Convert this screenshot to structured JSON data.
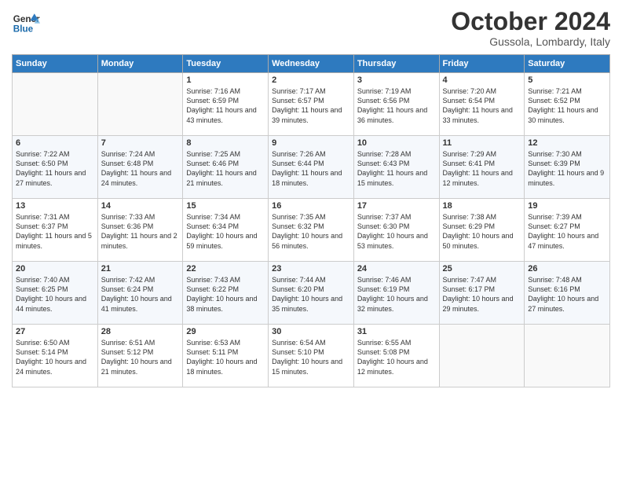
{
  "header": {
    "logo_line1": "General",
    "logo_line2": "Blue",
    "month": "October 2024",
    "location": "Gussola, Lombardy, Italy"
  },
  "days_of_week": [
    "Sunday",
    "Monday",
    "Tuesday",
    "Wednesday",
    "Thursday",
    "Friday",
    "Saturday"
  ],
  "weeks": [
    [
      {
        "day": "",
        "detail": ""
      },
      {
        "day": "",
        "detail": ""
      },
      {
        "day": "1",
        "detail": "Sunrise: 7:16 AM\nSunset: 6:59 PM\nDaylight: 11 hours and 43 minutes."
      },
      {
        "day": "2",
        "detail": "Sunrise: 7:17 AM\nSunset: 6:57 PM\nDaylight: 11 hours and 39 minutes."
      },
      {
        "day": "3",
        "detail": "Sunrise: 7:19 AM\nSunset: 6:56 PM\nDaylight: 11 hours and 36 minutes."
      },
      {
        "day": "4",
        "detail": "Sunrise: 7:20 AM\nSunset: 6:54 PM\nDaylight: 11 hours and 33 minutes."
      },
      {
        "day": "5",
        "detail": "Sunrise: 7:21 AM\nSunset: 6:52 PM\nDaylight: 11 hours and 30 minutes."
      }
    ],
    [
      {
        "day": "6",
        "detail": "Sunrise: 7:22 AM\nSunset: 6:50 PM\nDaylight: 11 hours and 27 minutes."
      },
      {
        "day": "7",
        "detail": "Sunrise: 7:24 AM\nSunset: 6:48 PM\nDaylight: 11 hours and 24 minutes."
      },
      {
        "day": "8",
        "detail": "Sunrise: 7:25 AM\nSunset: 6:46 PM\nDaylight: 11 hours and 21 minutes."
      },
      {
        "day": "9",
        "detail": "Sunrise: 7:26 AM\nSunset: 6:44 PM\nDaylight: 11 hours and 18 minutes."
      },
      {
        "day": "10",
        "detail": "Sunrise: 7:28 AM\nSunset: 6:43 PM\nDaylight: 11 hours and 15 minutes."
      },
      {
        "day": "11",
        "detail": "Sunrise: 7:29 AM\nSunset: 6:41 PM\nDaylight: 11 hours and 12 minutes."
      },
      {
        "day": "12",
        "detail": "Sunrise: 7:30 AM\nSunset: 6:39 PM\nDaylight: 11 hours and 9 minutes."
      }
    ],
    [
      {
        "day": "13",
        "detail": "Sunrise: 7:31 AM\nSunset: 6:37 PM\nDaylight: 11 hours and 5 minutes."
      },
      {
        "day": "14",
        "detail": "Sunrise: 7:33 AM\nSunset: 6:36 PM\nDaylight: 11 hours and 2 minutes."
      },
      {
        "day": "15",
        "detail": "Sunrise: 7:34 AM\nSunset: 6:34 PM\nDaylight: 10 hours and 59 minutes."
      },
      {
        "day": "16",
        "detail": "Sunrise: 7:35 AM\nSunset: 6:32 PM\nDaylight: 10 hours and 56 minutes."
      },
      {
        "day": "17",
        "detail": "Sunrise: 7:37 AM\nSunset: 6:30 PM\nDaylight: 10 hours and 53 minutes."
      },
      {
        "day": "18",
        "detail": "Sunrise: 7:38 AM\nSunset: 6:29 PM\nDaylight: 10 hours and 50 minutes."
      },
      {
        "day": "19",
        "detail": "Sunrise: 7:39 AM\nSunset: 6:27 PM\nDaylight: 10 hours and 47 minutes."
      }
    ],
    [
      {
        "day": "20",
        "detail": "Sunrise: 7:40 AM\nSunset: 6:25 PM\nDaylight: 10 hours and 44 minutes."
      },
      {
        "day": "21",
        "detail": "Sunrise: 7:42 AM\nSunset: 6:24 PM\nDaylight: 10 hours and 41 minutes."
      },
      {
        "day": "22",
        "detail": "Sunrise: 7:43 AM\nSunset: 6:22 PM\nDaylight: 10 hours and 38 minutes."
      },
      {
        "day": "23",
        "detail": "Sunrise: 7:44 AM\nSunset: 6:20 PM\nDaylight: 10 hours and 35 minutes."
      },
      {
        "day": "24",
        "detail": "Sunrise: 7:46 AM\nSunset: 6:19 PM\nDaylight: 10 hours and 32 minutes."
      },
      {
        "day": "25",
        "detail": "Sunrise: 7:47 AM\nSunset: 6:17 PM\nDaylight: 10 hours and 29 minutes."
      },
      {
        "day": "26",
        "detail": "Sunrise: 7:48 AM\nSunset: 6:16 PM\nDaylight: 10 hours and 27 minutes."
      }
    ],
    [
      {
        "day": "27",
        "detail": "Sunrise: 6:50 AM\nSunset: 5:14 PM\nDaylight: 10 hours and 24 minutes."
      },
      {
        "day": "28",
        "detail": "Sunrise: 6:51 AM\nSunset: 5:12 PM\nDaylight: 10 hours and 21 minutes."
      },
      {
        "day": "29",
        "detail": "Sunrise: 6:53 AM\nSunset: 5:11 PM\nDaylight: 10 hours and 18 minutes."
      },
      {
        "day": "30",
        "detail": "Sunrise: 6:54 AM\nSunset: 5:10 PM\nDaylight: 10 hours and 15 minutes."
      },
      {
        "day": "31",
        "detail": "Sunrise: 6:55 AM\nSunset: 5:08 PM\nDaylight: 10 hours and 12 minutes."
      },
      {
        "day": "",
        "detail": ""
      },
      {
        "day": "",
        "detail": ""
      }
    ]
  ]
}
